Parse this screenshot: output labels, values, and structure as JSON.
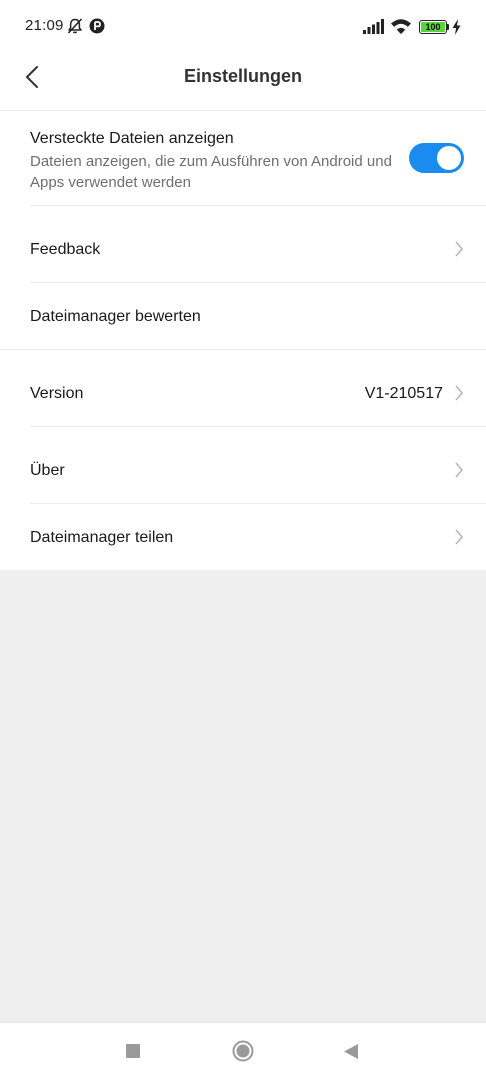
{
  "status_bar": {
    "time": "21:09",
    "icons": [
      "bell-off-icon",
      "app-notification-icon",
      "signal-icon",
      "wifi-icon",
      "battery-icon",
      "charging-icon"
    ],
    "battery_level": "100",
    "battery_color": "#56d43a"
  },
  "header": {
    "title": "Einstellungen",
    "back_icon": "chevron-left-icon"
  },
  "settings": {
    "hidden_files": {
      "label": "Versteckte Dateien anzeigen",
      "description": "Dateien anzeigen, die zum Ausführen von Android und Apps verwendet werden",
      "enabled": true,
      "toggle_color": "#1a8cf0"
    },
    "feedback": {
      "label": "Feedback"
    },
    "rate": {
      "label": "Dateimanager bewerten"
    },
    "version": {
      "label": "Version",
      "value": "V1-210517"
    },
    "about": {
      "label": "Über"
    },
    "share": {
      "label": "Dateimanager teilen"
    }
  },
  "nav_bar": {
    "icons": [
      "recents-icon",
      "home-icon",
      "back-icon"
    ]
  }
}
